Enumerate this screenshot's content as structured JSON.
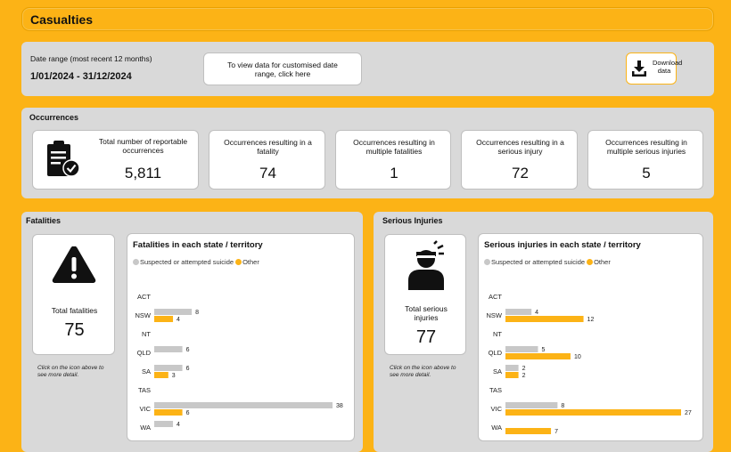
{
  "header": {
    "title": "Casualties"
  },
  "date_range": {
    "label": "Date range (most recent 12 months)",
    "value": "1/01/2024 - 31/12/2024",
    "custom_button": "To view data for customised date range, click here",
    "download_label": "Download data"
  },
  "occurrences": {
    "title": "Occurrences",
    "cards": [
      {
        "label": "Total number of reportable occurrences",
        "value": "5,811"
      },
      {
        "label": "Occurrences resulting in a fatality",
        "value": "74"
      },
      {
        "label": "Occurrences resulting in multiple fatalities",
        "value": "1"
      },
      {
        "label": "Occurrences resulting in a serious injury",
        "value": "72"
      },
      {
        "label": "Occurrences resulting in multiple serious injuries",
        "value": "5"
      }
    ]
  },
  "fatalities": {
    "title": "Fatalities",
    "total_label": "Total fatalities",
    "total_value": "75",
    "note": "Click on the icon above to see more detail."
  },
  "serious_injuries": {
    "title": "Serious Injuries",
    "total_label": "Total serious injuries",
    "total_value": "77",
    "note": "Click on the icon above to see more detail."
  },
  "colors": {
    "accent": "#fcb316",
    "grey": "#c8c8c8",
    "panel": "#d9d9d9"
  },
  "icons": [
    "clipboard-check-icon",
    "download-icon",
    "warning-triangle-icon",
    "injured-person-icon"
  ],
  "chart_data": [
    {
      "type": "bar",
      "orientation": "horizontal",
      "title": "Fatalities in each state / territory",
      "legend": [
        "Suspected or attempted suicide",
        "Other"
      ],
      "categories": [
        "ACT",
        "NSW",
        "NT",
        "QLD",
        "SA",
        "TAS",
        "VIC",
        "WA"
      ],
      "series": [
        {
          "name": "Suspected or attempted suicide",
          "color": "#c8c8c8",
          "values": [
            null,
            8,
            null,
            6,
            6,
            null,
            38,
            4
          ]
        },
        {
          "name": "Other",
          "color": "#fcb316",
          "values": [
            null,
            4,
            null,
            null,
            3,
            null,
            6,
            null
          ]
        }
      ],
      "xlim": [
        0,
        38
      ]
    },
    {
      "type": "bar",
      "orientation": "horizontal",
      "title": "Serious injuries in each state / territory",
      "legend": [
        "Suspected or attempted suicide",
        "Other"
      ],
      "categories": [
        "ACT",
        "NSW",
        "NT",
        "QLD",
        "SA",
        "TAS",
        "VIC",
        "WA"
      ],
      "series": [
        {
          "name": "Suspected or attempted suicide",
          "color": "#c8c8c8",
          "values": [
            null,
            4,
            null,
            5,
            2,
            null,
            8,
            null
          ]
        },
        {
          "name": "Other",
          "color": "#fcb316",
          "values": [
            null,
            12,
            null,
            10,
            2,
            null,
            27,
            7
          ]
        }
      ],
      "xlim": [
        0,
        27
      ]
    }
  ]
}
